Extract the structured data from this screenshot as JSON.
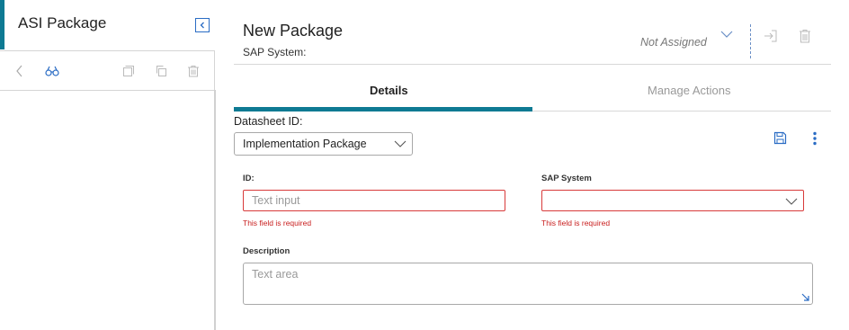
{
  "left_panel": {
    "title": "ASI Package",
    "toolbar_icons": [
      "back-arrow-icon",
      "binoculars-icon",
      "copy-icon",
      "duplicate-icon",
      "trash-icon"
    ]
  },
  "header": {
    "title": "New Package",
    "subtitle": "SAP System:",
    "assignment": "Not Assigned"
  },
  "tabs": [
    {
      "label": "Details",
      "active": true
    },
    {
      "label": "Manage Actions",
      "active": false
    }
  ],
  "datasheet": {
    "label": "Datasheet ID:",
    "selected": "Implementation Package"
  },
  "form": {
    "id_label": "ID:",
    "id_placeholder": "Text input",
    "id_error": "This field is required",
    "sap_label": "SAP System",
    "sap_value": "",
    "sap_error": "This field is required",
    "description_label": "Description",
    "description_placeholder": "Text area"
  },
  "colors": {
    "accent": "#0e7a93",
    "link": "#2a6cc4",
    "error": "#c81e1e"
  }
}
